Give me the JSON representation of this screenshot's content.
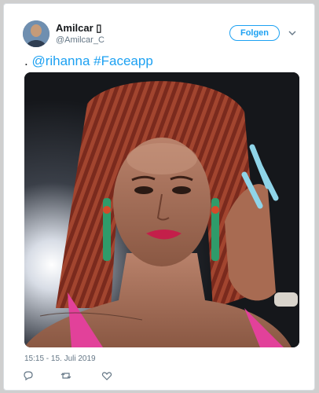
{
  "tweet": {
    "author": {
      "display_name": "Amilcar ▯",
      "handle": "@Amilcar_C"
    },
    "follow_label": "Folgen",
    "text_prefix": ". ",
    "mention": "@rihanna",
    "hashtag": "#Faceapp",
    "timestamp": "15:15 - 15. Juli 2019",
    "icons": [
      "reply-icon",
      "retweet-icon",
      "like-icon",
      "more-caret-icon"
    ],
    "colors": {
      "accent": "#1da1f2",
      "text": "#14171a",
      "muted": "#657786"
    }
  }
}
